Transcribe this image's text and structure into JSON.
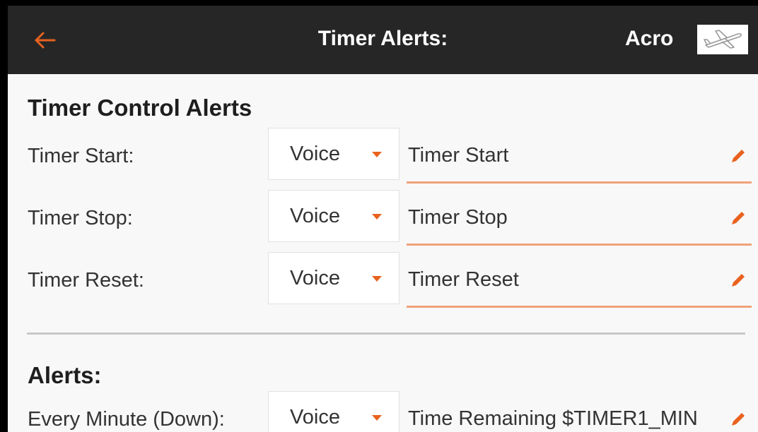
{
  "header": {
    "title": "Timer Alerts:",
    "model_name": "Acro",
    "back_icon": "arrow-left-icon",
    "model_icon": "airplane-icon"
  },
  "timer_control": {
    "title": "Timer Control Alerts",
    "rows": [
      {
        "label": "Timer Start:",
        "mode": "Voice",
        "text": "Timer Start"
      },
      {
        "label": "Timer Stop:",
        "mode": "Voice",
        "text": "Timer Stop"
      },
      {
        "label": "Timer Reset:",
        "mode": "Voice",
        "text": "Timer Reset"
      }
    ]
  },
  "alerts": {
    "title": "Alerts:",
    "rows": [
      {
        "label": "Every Minute (Down):",
        "mode": "Voice",
        "text": "Time Remaining $TIMER1_MIN"
      }
    ]
  },
  "colors": {
    "accent": "#e8621e",
    "header_bg": "#262626",
    "background": "#f8f8f8"
  }
}
